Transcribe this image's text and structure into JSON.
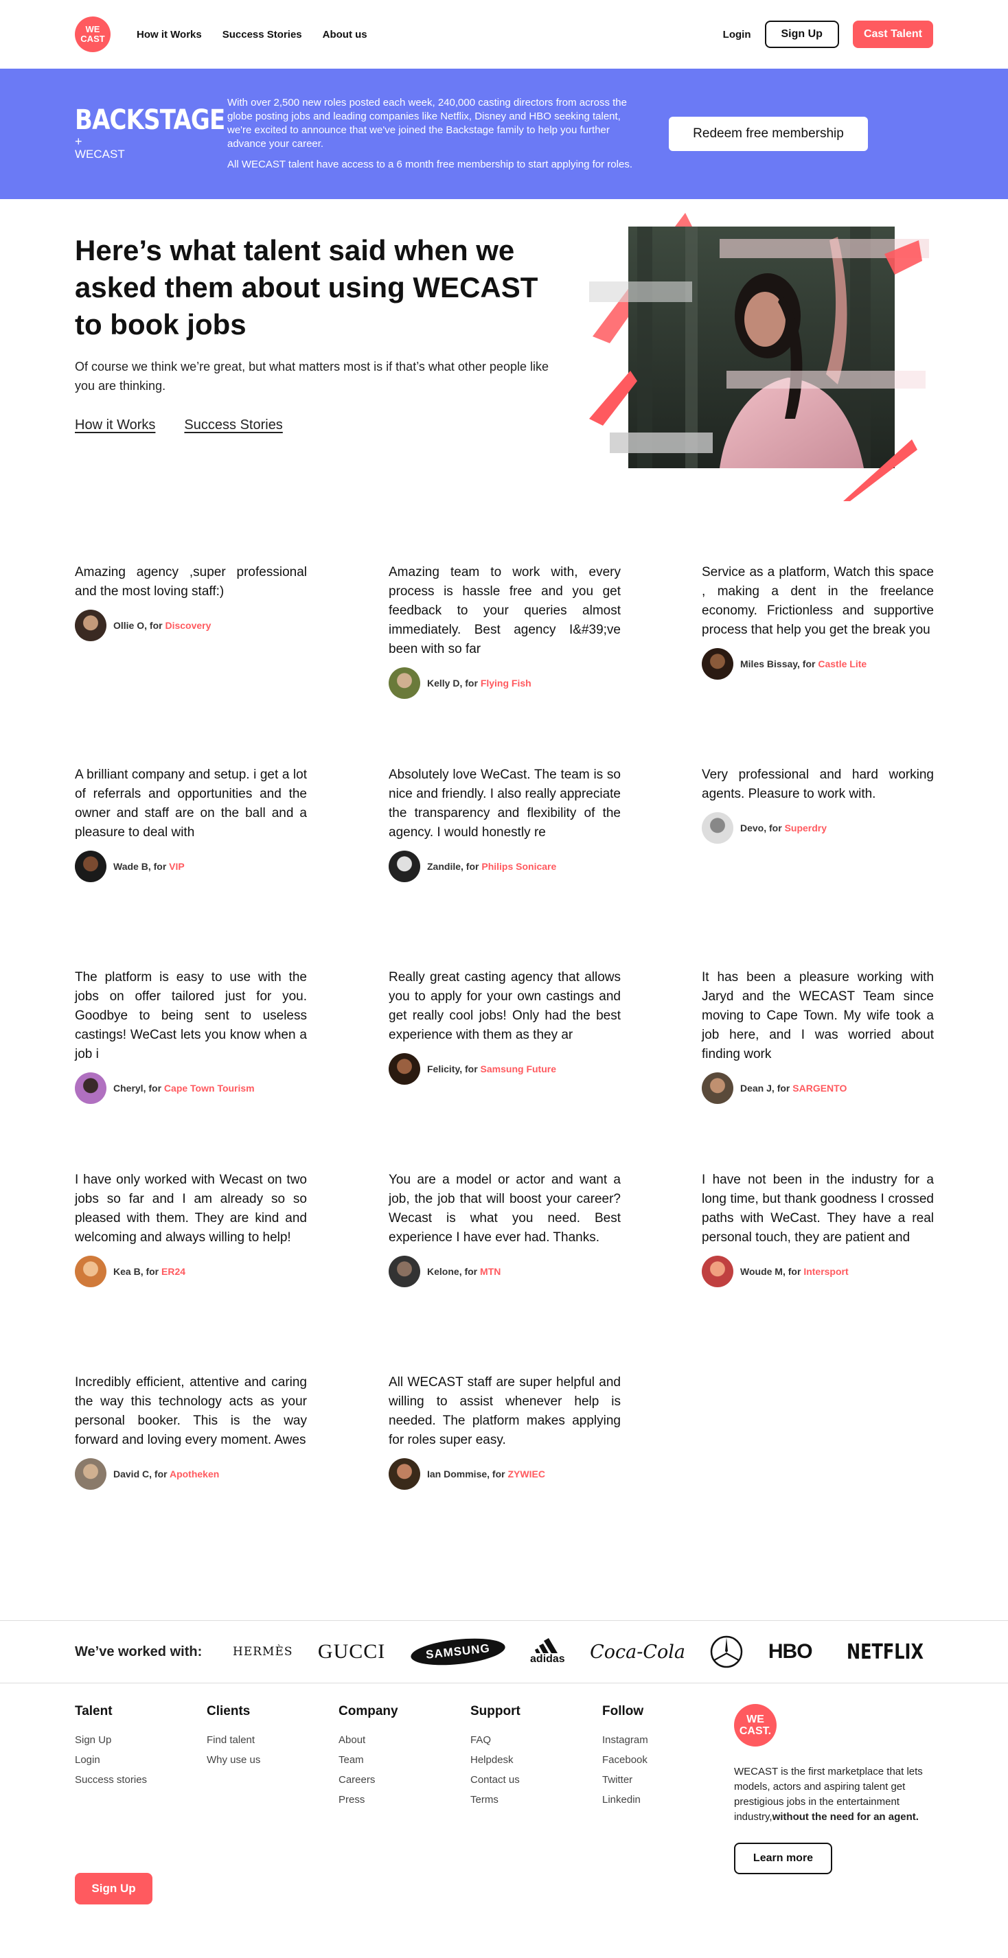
{
  "header": {
    "logo_text": "WE CAST",
    "nav": [
      "How it Works",
      "Success Stories",
      "About us"
    ],
    "login": "Login",
    "signup": "Sign Up",
    "cast_talent": "Cast Talent"
  },
  "banner": {
    "logo_word": "BACKSTAGE",
    "logo_plus": "+",
    "logo_sub": "WECAST",
    "text1": "With over 2,500 new roles posted each week, 240,000 casting directors from across the globe posting jobs and leading companies like Netflix, Disney and HBO seeking talent, we're excited to announce that we've joined the Backstage family to help you further advance your career.",
    "text2": "All WECAST talent have access to a 6 month free membership to start applying for roles.",
    "cta": "Redeem free membership"
  },
  "hero": {
    "title": "Here’s what talent said when we asked them about using WECAST to book jobs",
    "lead": "Of course we think we’re great, but what matters most is if that’s what other people like you are thinking.",
    "links": [
      "How it Works",
      "Success Stories"
    ]
  },
  "testimonials": [
    {
      "quote": "Amazing agency ,super professional and the most loving staff:)",
      "name": "Ollie O",
      "client": "Discovery"
    },
    {
      "quote": "Amazing team to work with, every process is hassle free and you get feedback to your queries almost immediately. Best agency I&#39;ve been with so far",
      "name": "Kelly D",
      "client": "Flying Fish"
    },
    {
      "quote": "Service as a platform, Watch this space , making a dent in the freelance economy. Frictionless and supportive process that help you get the break you",
      "name": "Miles Bissay",
      "client": "Castle Lite"
    },
    {
      "quote": "A brilliant company and setup. i get a lot of referrals and opportunities and the owner and staff are on the ball and a pleasure to deal with",
      "name": "Wade B",
      "client": "VIP"
    },
    {
      "quote": "Absolutely love WeCast. The team is so nice and friendly. I also really appreciate the transparency and flexibility of the agency. I would honestly re",
      "name": "Zandile",
      "client": "Philips Sonicare"
    },
    {
      "quote": "Very professional and hard working agents. Pleasure to work with.",
      "name": "Devo",
      "client": "Superdry"
    },
    {
      "quote": "The platform is easy to use with the jobs on offer tailored just for you. Goodbye to being sent to useless castings! WeCast lets you know when a job i",
      "name": "Cheryl",
      "client": "Cape Town Tourism"
    },
    {
      "quote": "Really great casting agency that allows you to apply for your own castings and get really cool jobs! Only had the best experience with them as they ar",
      "name": "Felicity",
      "client": "Samsung Future"
    },
    {
      "quote": "It has been a pleasure working with Jaryd and the WECAST Team since moving to Cape Town. My wife took a job here, and I was worried about finding work",
      "name": "Dean J",
      "client": "SARGENTO"
    },
    {
      "quote": "I have only worked with Wecast on two jobs so far and I am already so so pleased with them. They are kind and welcoming and always willing to help!",
      "name": "Kea B",
      "client": "ER24"
    },
    {
      "quote": "You are a model or actor and want a job, the job that will boost your career? Wecast is what you need. Best experience I have ever had. Thanks.",
      "name": "Kelone",
      "client": "MTN"
    },
    {
      "quote": "I have not been in the industry for a long time, but thank goodness I crossed paths with WeCast. They have a real personal touch, they are patient and",
      "name": "Woude M",
      "client": "Intersport"
    },
    {
      "quote": "Incredibly efficient, attentive and caring the way this technology acts as your personal booker. This is the way forward and loving every moment. Awes",
      "name": "David C",
      "client": "Apotheken"
    },
    {
      "quote": "All WECAST staff are super helpful and willing to assist whenever help is needed. The platform makes applying for roles super easy.",
      "name": "Ian Dommise",
      "client": "ZYWIEC"
    }
  ],
  "for_word": "for",
  "partners": {
    "label": "We’ve worked with:",
    "logos": [
      "HERMÈS",
      "GUCCI",
      "SAMSUNG",
      "adidas",
      "Coca-Cola",
      "Mercedes-Benz",
      "HBO",
      "NETFLIX"
    ]
  },
  "footer": {
    "columns": [
      {
        "title": "Talent",
        "links": [
          "Sign Up",
          "Login",
          "Success stories"
        ]
      },
      {
        "title": "Clients",
        "links": [
          "Find talent",
          "Why use us"
        ]
      },
      {
        "title": "Company",
        "links": [
          "About",
          "Team",
          "Careers",
          "Press"
        ]
      },
      {
        "title": "Support",
        "links": [
          "FAQ",
          "Helpdesk",
          "Contact us",
          "Terms"
        ]
      },
      {
        "title": "Follow",
        "links": [
          "Instagram",
          "Facebook",
          "Twitter",
          "Linkedin"
        ]
      }
    ],
    "logo_text": "WE CAST.",
    "desc": "WECAST is the first marketplace that lets models, actors and aspiring talent get prestigious jobs in the entertainment industry,",
    "desc_bold": "without the need for an agent.",
    "learn_more": "Learn more",
    "signup": "Sign Up"
  },
  "colors": {
    "accent": "#ff5a5f",
    "banner": "#6b7af5"
  }
}
